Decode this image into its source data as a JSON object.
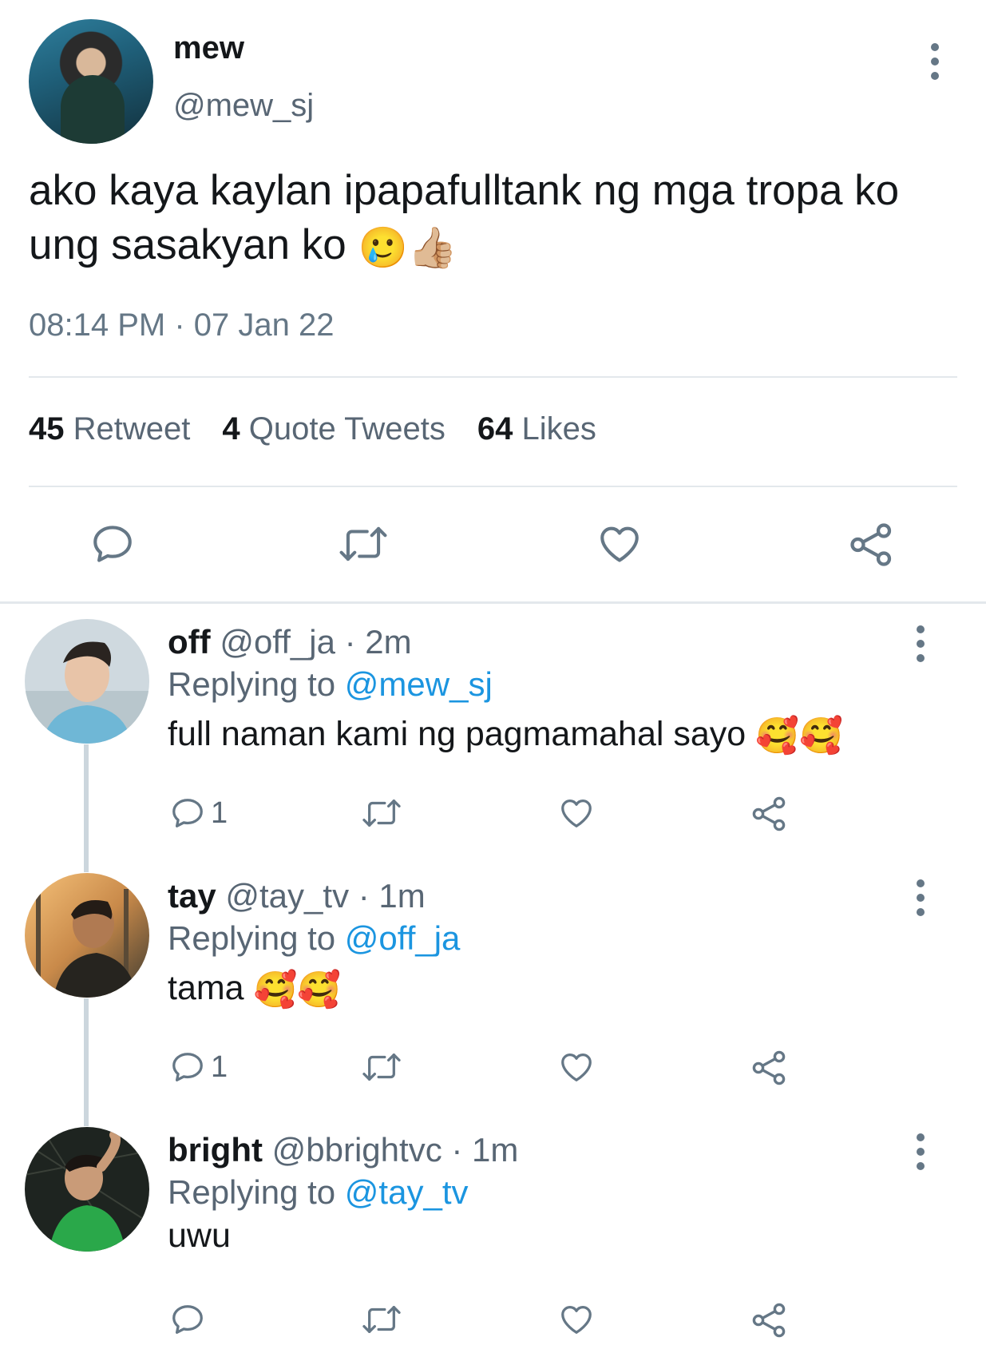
{
  "main_tweet": {
    "display_name": "mew",
    "handle": "@mew_sj",
    "text": "ako kaya kaylan ipapafulltank ng mga tropa ko ung sasakyan ko",
    "emojis": [
      "🥲",
      "👍🏼"
    ],
    "timestamp": "08:14 PM · 07 Jan 22",
    "stats": {
      "retweets_count": "45",
      "retweets_label": "Retweet",
      "quotes_count": "4",
      "quotes_label": "Quote Tweets",
      "likes_count": "64",
      "likes_label": "Likes"
    },
    "icons": [
      "reply-icon",
      "retweet-icon",
      "like-icon",
      "share-icon",
      "more-icon"
    ]
  },
  "replies": [
    {
      "display_name": "off",
      "handle": "@off_ja",
      "time": "· 2m",
      "replying_prefix": "Replying to",
      "replying_to": "@mew_sj",
      "text": "full naman kami ng pagmamahal sayo",
      "emojis": "🥰🥰",
      "reply_count": "1"
    },
    {
      "display_name": "tay",
      "handle": "@tay_tv",
      "time": "· 1m",
      "replying_prefix": "Replying to",
      "replying_to": "@off_ja",
      "text": "tama",
      "emojis": "🥰🥰",
      "reply_count": "1"
    },
    {
      "display_name": "bright",
      "handle": "@bbrightvc",
      "time": "· 1m",
      "replying_prefix": "Replying to",
      "replying_to": "@tay_tv",
      "text": "uwu",
      "emojis": "",
      "reply_count": ""
    }
  ],
  "colors": {
    "text": "#14171a",
    "secondary": "#586674",
    "mention": "#1b95e0",
    "divider": "#e3e8ec",
    "thread_line": "#ccd6dd"
  }
}
